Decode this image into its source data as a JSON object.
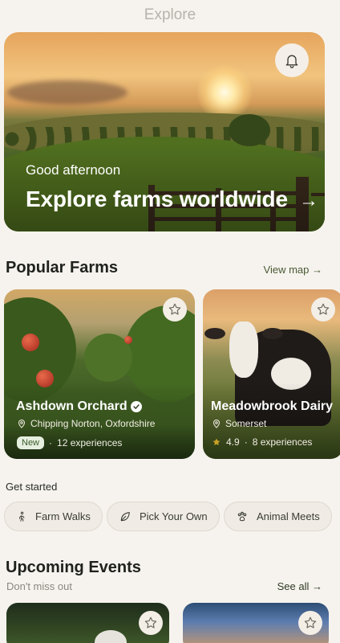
{
  "header": {
    "title": "Explore"
  },
  "hero": {
    "greeting": "Good afternoon",
    "title": "Explore farms worldwide",
    "arrow": "→",
    "bell_icon": "bell-icon"
  },
  "popular": {
    "title": "Popular Farms",
    "view_map": "View map →",
    "farms": [
      {
        "name": "Ashdown Orchard",
        "verified": true,
        "location": "Chipping Norton, Oxfordshire",
        "badge": "New",
        "experiences": "12 experiences"
      },
      {
        "name": "Meadowbrook Dairy",
        "location": "Somerset",
        "rating": "4.9",
        "experiences": "8 experiences"
      }
    ]
  },
  "get_started": {
    "title": "Get started",
    "chips": [
      {
        "label": "Farm Walks",
        "icon": "walking-icon"
      },
      {
        "label": "Pick Your Own",
        "icon": "leaf-icon"
      },
      {
        "label": "Animal Meets",
        "icon": "paw-icon"
      }
    ]
  },
  "events": {
    "title": "Upcoming Events",
    "subtitle": "Don't miss out",
    "see_all": "See all →"
  },
  "colors": {
    "background": "#f6f3ee",
    "accent": "#4a5a34",
    "star": "#c9a227"
  }
}
